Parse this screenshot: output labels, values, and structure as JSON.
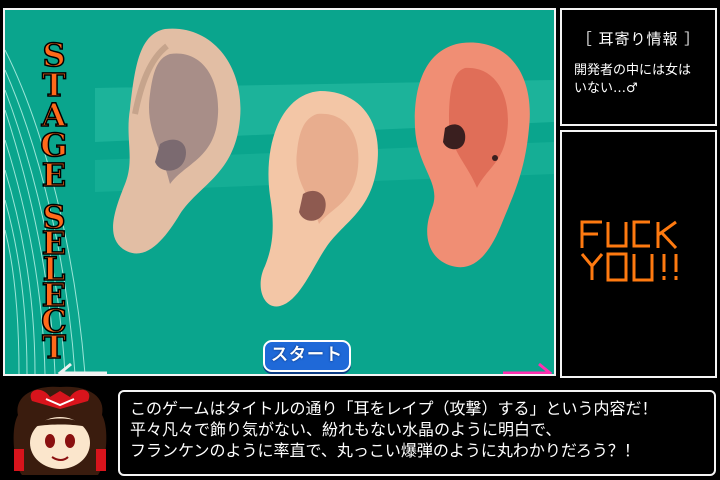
{
  "stage_select": {
    "title_letters": [
      "S",
      "T",
      "A",
      "G",
      "E",
      "S",
      "E",
      "L",
      "E",
      "C",
      "T"
    ],
    "start_label": "スタート",
    "prev_arrow_icon": "arrow-left-icon",
    "next_arrow_icon": "arrow-right-icon",
    "colors": {
      "background": "#0aa58d",
      "title_fill": "#ff6a1a",
      "start_button": "#1f69d8",
      "prev_arrow": "#f0f0f0",
      "next_arrow": "#ff2fb0"
    }
  },
  "info": {
    "title": "［ 耳寄り情報 ］",
    "lines": [
      "開発者の中には女は",
      "いない…♂"
    ]
  },
  "logo": {
    "text": "FUCK YOU!!",
    "color": "#ff7a10"
  },
  "dialogue": {
    "lines": [
      "このゲームはタイトルの通り「耳をレイプ（攻撃）する」という内容だ！",
      "平々凡々で飾り気がない、紛れもない水晶のように明白で、",
      "フランケンのように率直で、丸っこい爆弾のように丸わかりだろう？！"
    ]
  }
}
